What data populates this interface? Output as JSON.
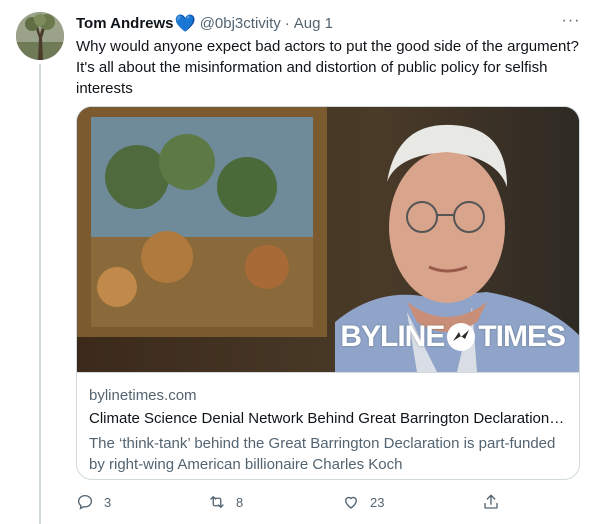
{
  "tweet": {
    "author_name": "Tom Andrews",
    "verified_symbol": "💙",
    "handle": "@0bj3ctivity",
    "separator": "·",
    "date": "Aug 1",
    "more_symbol": "···",
    "text": "Why would anyone expect bad actors to put the good side of the argument? It's all about the misinformation and distortion of public policy for selfish interests"
  },
  "card": {
    "watermark_left": "BYLINE",
    "watermark_right": "TIMES",
    "domain": "bylinetimes.com",
    "title": "Climate Science Denial Network Behind Great Barrington Declaration –...",
    "description": "The ‘think-tank’ behind the Great Barrington Declaration is part-funded by right-wing American billionaire Charles Koch"
  },
  "actions": {
    "replies": "3",
    "retweets": "8",
    "likes": "23"
  },
  "icons": {
    "reply": "reply-icon",
    "retweet": "retweet-icon",
    "like": "heart-icon",
    "share": "share-icon"
  },
  "colors": {
    "text_primary": "#0f1419",
    "text_secondary": "#536471",
    "border": "#cfd9de",
    "heart_emoji": "#6ea8e0"
  }
}
